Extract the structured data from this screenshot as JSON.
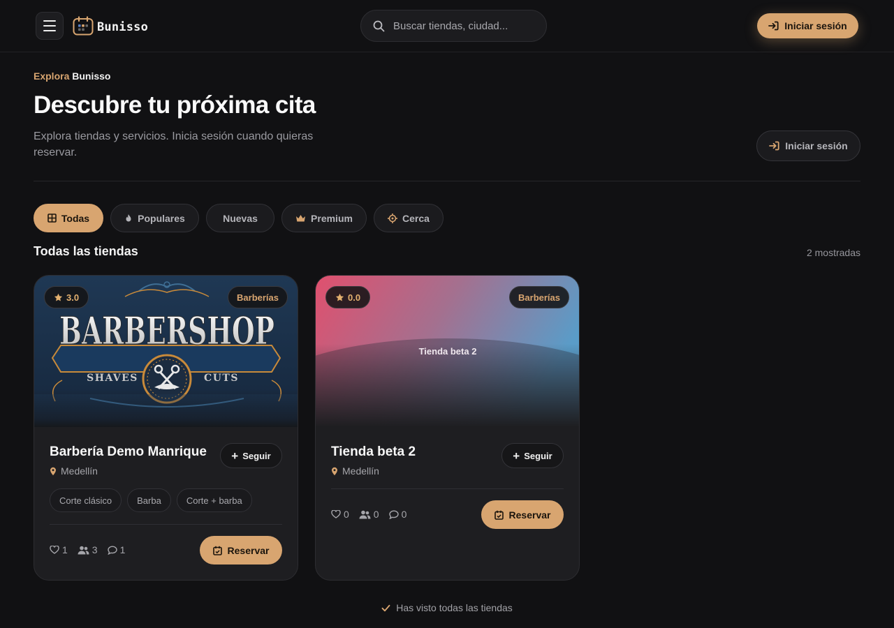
{
  "header": {
    "brand": "Bunisso",
    "search_placeholder": "Buscar tiendas, ciudad...",
    "login_label": "Iniciar sesión"
  },
  "hero": {
    "eyebrow_accent": "Explora",
    "eyebrow_brand": "Bunisso",
    "title": "Descubre tu próxima cita",
    "subtitle": "Explora tiendas y servicios. Inicia sesión cuando quieras reservar.",
    "login_label": "Iniciar sesión"
  },
  "filters": [
    {
      "label": "Todas",
      "icon": "grid-icon",
      "active": true
    },
    {
      "label": "Populares",
      "icon": "flame-icon",
      "active": false
    },
    {
      "label": "Nuevas",
      "icon": "",
      "active": false
    },
    {
      "label": "Premium",
      "icon": "crown-icon",
      "active": false
    },
    {
      "label": "Cerca",
      "icon": "crosshair-icon",
      "active": false
    }
  ],
  "section": {
    "title": "Todas las tiendas",
    "count": "2 mostradas"
  },
  "stores": [
    {
      "name": "Barbería Demo Manrique",
      "rating": "3.0",
      "category": "Barberías",
      "city": "Medellín",
      "follow_label": "Seguir",
      "tags": [
        "Corte clásico",
        "Barba",
        "Corte + barba"
      ],
      "likes": "1",
      "followers": "3",
      "comments": "1",
      "reserve_label": "Reservar",
      "cover_text": {
        "main": "BARBERSHOP",
        "left": "SHAVES",
        "right": "CUTS"
      }
    },
    {
      "name": "Tienda beta 2",
      "rating": "0.0",
      "category": "Barberías",
      "city": "Medellín",
      "follow_label": "Seguir",
      "tags": [],
      "likes": "0",
      "followers": "0",
      "comments": "0",
      "reserve_label": "Reservar",
      "cover_label": "Tienda beta 2"
    }
  ],
  "footer": {
    "note": "Has visto todas las tiendas"
  },
  "colors": {
    "accent": "#d8a570",
    "background": "#111113",
    "card": "#1e1e21"
  }
}
